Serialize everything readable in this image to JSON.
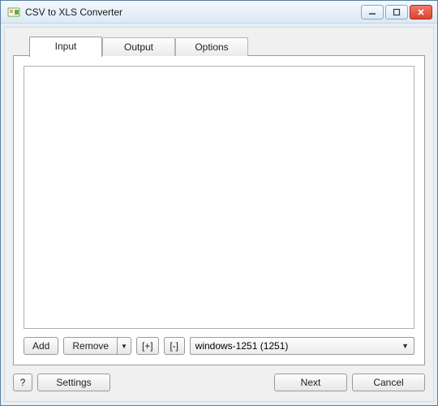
{
  "window": {
    "title": "CSV to XLS Converter"
  },
  "tabs": {
    "input": "Input",
    "output": "Output",
    "options": "Options"
  },
  "input_panel": {
    "add": "Add",
    "remove": "Remove",
    "expand": "[+]",
    "collapse": "[-]",
    "encoding_selected": "windows-1251 (1251)"
  },
  "footer": {
    "help": "?",
    "settings": "Settings",
    "next": "Next",
    "cancel": "Cancel"
  }
}
